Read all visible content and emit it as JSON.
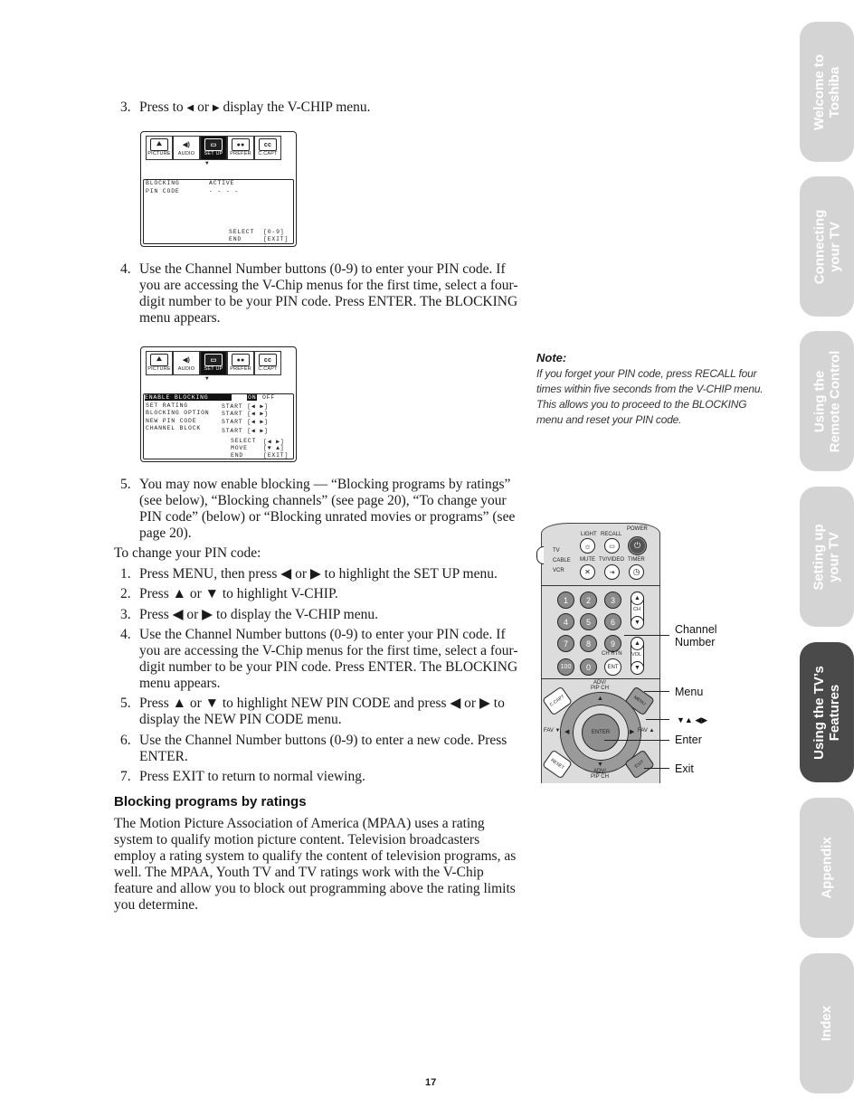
{
  "step3_top": {
    "num": "3.",
    "text_a": "Press to ",
    "left_glyph": "◀",
    "text_b": " or ",
    "right_glyph": "▶",
    "text_c": " display the V-CHIP menu."
  },
  "osd1": {
    "tabs": [
      {
        "label": "PICTURE",
        "icon": "picture-icon",
        "glyph": "⛰"
      },
      {
        "label": "AUDIO",
        "icon": "speaker-icon",
        "glyph": "🔊"
      },
      {
        "label": "SET UP",
        "icon": "tv-icon",
        "glyph": "▭"
      },
      {
        "label": "PREFER",
        "icon": "camera-icon",
        "glyph": "🎥"
      },
      {
        "label": "C.CAPT",
        "icon": "cc-icon",
        "glyph": "CC"
      }
    ],
    "pointer": "▼",
    "rows": [
      {
        "label": "BLOCKING",
        "value": "ACTIVE"
      },
      {
        "label": "PIN CODE",
        "value": "- - - -"
      }
    ],
    "footer": [
      {
        "label": "SELECT",
        "value": "[0-9]"
      },
      {
        "label": "END",
        "value": "[EXIT]"
      }
    ]
  },
  "step4": {
    "num": "4.",
    "text": "Use the Channel Number buttons (0-9) to enter your PIN code. If you are accessing the V-Chip menus for the first time, select a four-digit number to be your PIN code. Press ENTER. The BLOCKING menu appears."
  },
  "osd2": {
    "tabs": [
      {
        "label": "PICTURE",
        "glyph": "⛰"
      },
      {
        "label": "AUDIO",
        "glyph": "🔊"
      },
      {
        "label": "SET UP",
        "glyph": "▭"
      },
      {
        "label": "PREFER",
        "glyph": "🎥"
      },
      {
        "label": "C.CAPT",
        "glyph": "CC"
      }
    ],
    "pointer": "▼",
    "enable_row": {
      "label": "ENABLE BLOCKING",
      "on": "ON",
      "off": "OFF"
    },
    "rows": [
      {
        "label": "SET RATING",
        "value": "START [◀ ▶]"
      },
      {
        "label": "BLOCKING OPTION",
        "value": "START [◀ ▶]"
      },
      {
        "label": "NEW PIN CODE",
        "value": "START [◀ ▶]"
      },
      {
        "label": "CHANNEL BLOCK",
        "value": "START [◀ ▶]"
      }
    ],
    "footer": [
      {
        "label": "SELECT",
        "value": "[◀ ▶]"
      },
      {
        "label": "MOVE",
        "value": "[▼ ▲]"
      },
      {
        "label": "END",
        "value": "[EXIT]"
      }
    ]
  },
  "step5": {
    "num": "5.",
    "text": "You may now enable blocking — “Blocking programs by ratings” (see below), “Blocking channels” (see page 20), “To change your PIN code” (below) or “Blocking unrated movies or programs” (see page 20)."
  },
  "change_pin": {
    "intro": "To change your PIN code:",
    "steps": [
      {
        "num": "1.",
        "text": "Press MENU, then press ◀ or ▶ to highlight the SET UP menu."
      },
      {
        "num": "2.",
        "text": "Press ▲ or ▼ to highlight V-CHIP."
      },
      {
        "num": "3.",
        "text": "Press ◀ or ▶ to display the V-CHIP menu."
      },
      {
        "num": "4.",
        "text": "Use the Channel Number buttons (0-9) to enter your PIN code. If you are accessing the V-Chip menus for the first time, select a four-digit number to be your PIN code. Press ENTER. The BLOCKING menu appears."
      },
      {
        "num": "5.",
        "text": "Press ▲ or ▼ to highlight NEW PIN CODE and press ◀ or ▶ to display the NEW PIN CODE menu."
      },
      {
        "num": "6.",
        "text": "Use the Channel Number buttons (0-9) to enter a new code. Press ENTER."
      },
      {
        "num": "7.",
        "text": "Press EXIT to return to normal viewing."
      }
    ]
  },
  "section": {
    "heading": "Blocking programs by ratings",
    "body": "The Motion Picture Association of America (MPAA) uses a rating system to qualify motion picture content. Television broadcasters employ a rating system to qualify the content of television programs, as well. The MPAA, Youth TV and TV ratings work with the V-Chip feature and allow you to block out programming above the rating limits you determine."
  },
  "note": {
    "title": "Note:",
    "body": "If you forget your PIN code, press RECALL four times within five seconds from the V-CHIP menu. This allows you to proceed to the BLOCKING menu and reset your PIN code."
  },
  "remote": {
    "power": "POWER",
    "light": "LIGHT",
    "recall": "RECALL",
    "mute": "MUTE",
    "tvvideo": "TV/VIDEO",
    "timer": "TIMER",
    "mode_tv": "TV",
    "mode_cable": "CABLE",
    "mode_vcr": "VCR",
    "digits": [
      "1",
      "2",
      "3",
      "4",
      "5",
      "6",
      "7",
      "8",
      "9",
      "100",
      "0"
    ],
    "ent": "ENT",
    "ch": "CH",
    "vol": "VOL",
    "ch_rtn": "CH RTN",
    "adv_top": "ADV/\nPIP CH",
    "adv_bottom": "ADV/\nPIP CH",
    "ccapt": "C.CAPT",
    "menu": "MENU",
    "reset": "RESET",
    "exit": "EXIT",
    "enter": "ENTER",
    "fav_left": "FAV ▼",
    "fav_right": "FAV ▲",
    "callouts": {
      "channel_number": "Channel\nNumber",
      "menu": "Menu",
      "arrows": "▼▲ ◀▶",
      "enter": "Enter",
      "exit": "Exit"
    }
  },
  "side_tabs": [
    {
      "label": "Welcome to\nToshiba",
      "active": false
    },
    {
      "label": "Connecting\nyour TV",
      "active": false
    },
    {
      "label": "Using the\nRemote Control",
      "active": false
    },
    {
      "label": "Setting up\nyour TV",
      "active": false
    },
    {
      "label": "Using the TV’s\nFeatures",
      "active": true
    },
    {
      "label": "Appendix",
      "active": false
    },
    {
      "label": "Index",
      "active": false
    }
  ],
  "page_number": "17"
}
